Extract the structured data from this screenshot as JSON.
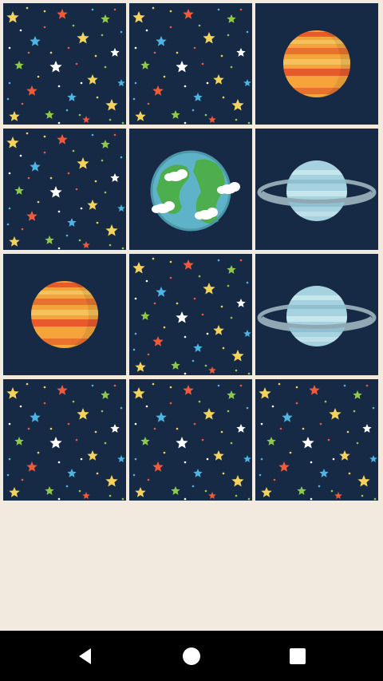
{
  "board": {
    "rows": 4,
    "cols": 3,
    "card_back_color": "#172a45",
    "cards": [
      {
        "state": "face-down",
        "face": "stars"
      },
      {
        "state": "face-down",
        "face": "stars"
      },
      {
        "state": "face-up",
        "face": "jupiter"
      },
      {
        "state": "face-down",
        "face": "stars"
      },
      {
        "state": "face-up",
        "face": "earth"
      },
      {
        "state": "face-up",
        "face": "saturn"
      },
      {
        "state": "face-up",
        "face": "jupiter"
      },
      {
        "state": "face-down",
        "face": "stars"
      },
      {
        "state": "face-up",
        "face": "saturn"
      },
      {
        "state": "face-down",
        "face": "stars"
      },
      {
        "state": "face-down",
        "face": "stars"
      },
      {
        "state": "face-down",
        "face": "stars"
      }
    ]
  },
  "navigation": {
    "back_icon": "back-triangle-icon",
    "home_icon": "home-circle-icon",
    "recents_icon": "recents-square-icon"
  },
  "colors": {
    "background": "#f2eadf",
    "navbar": "#000000",
    "star_palette": [
      "#f3d35b",
      "#ef5a3b",
      "#8fc94a",
      "#4cb5e3",
      "#ffffff"
    ]
  }
}
